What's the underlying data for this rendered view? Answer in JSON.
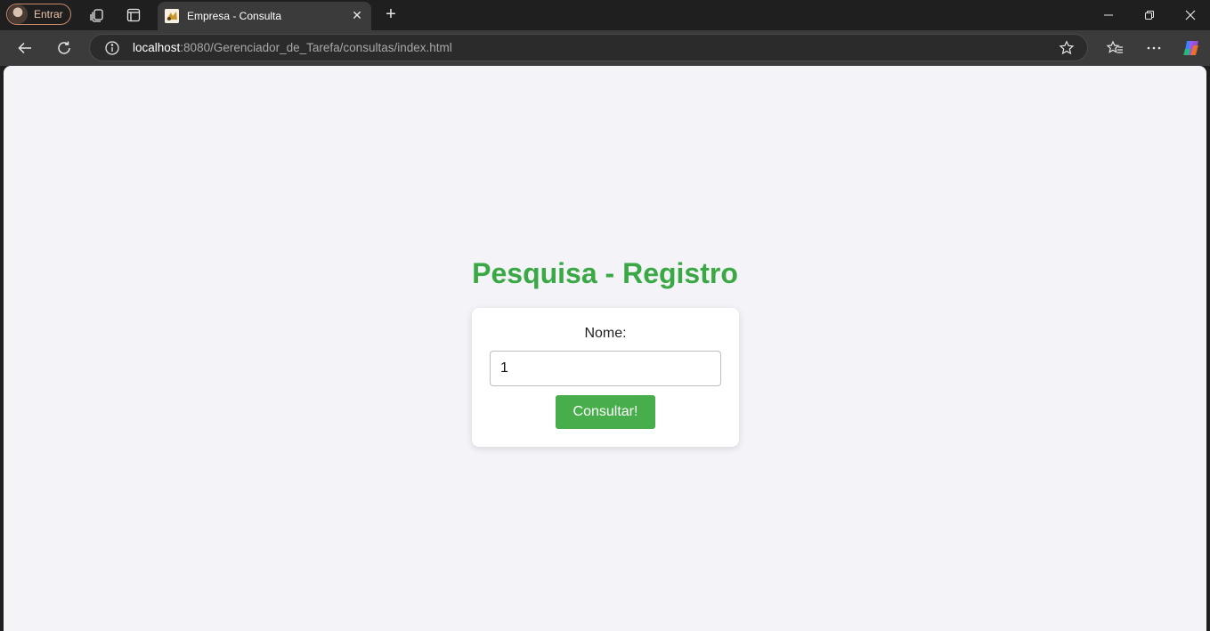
{
  "browser": {
    "profile_label": "Entrar",
    "tab_title": "Empresa - Consulta",
    "url_host": "localhost",
    "url_rest": ":8080/Gerenciador_de_Tarefa/consultas/index.html"
  },
  "page": {
    "heading": "Pesquisa - Registro",
    "form": {
      "name_label": "Nome:",
      "name_value": "1",
      "submit_label": "Consultar!"
    }
  },
  "colors": {
    "heading_green": "#3aa845",
    "button_green": "#47ae4b",
    "page_background": "#f4f4f8"
  }
}
